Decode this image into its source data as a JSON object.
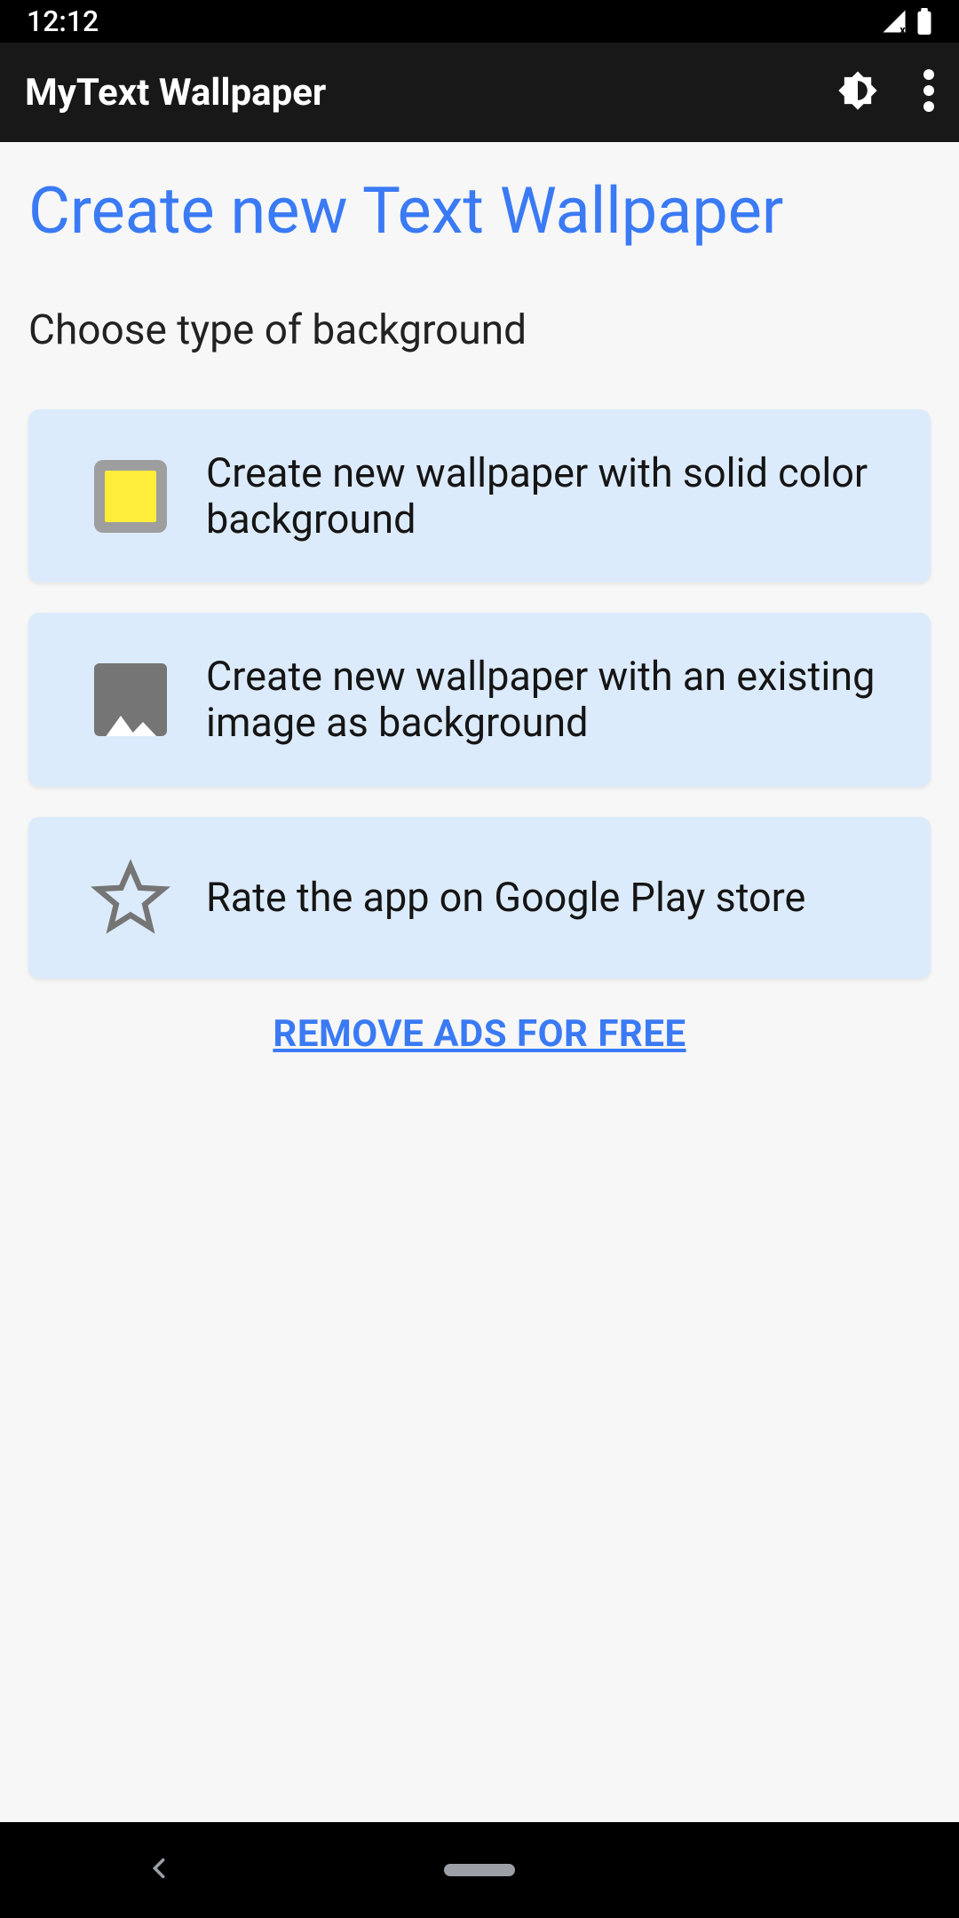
{
  "statusBar": {
    "time": "12:12"
  },
  "appBar": {
    "title": "MyText Wallpaper"
  },
  "main": {
    "heading": "Create new Text Wallpaper",
    "subtitle": "Choose type of background",
    "cards": [
      {
        "label": "Create new wallpaper with solid color background"
      },
      {
        "label": "Create new wallpaper with an existing image as background"
      },
      {
        "label": "Rate the app on Google Play store"
      }
    ],
    "removeAdsLabel": "REMOVE ADS FOR FREE"
  }
}
